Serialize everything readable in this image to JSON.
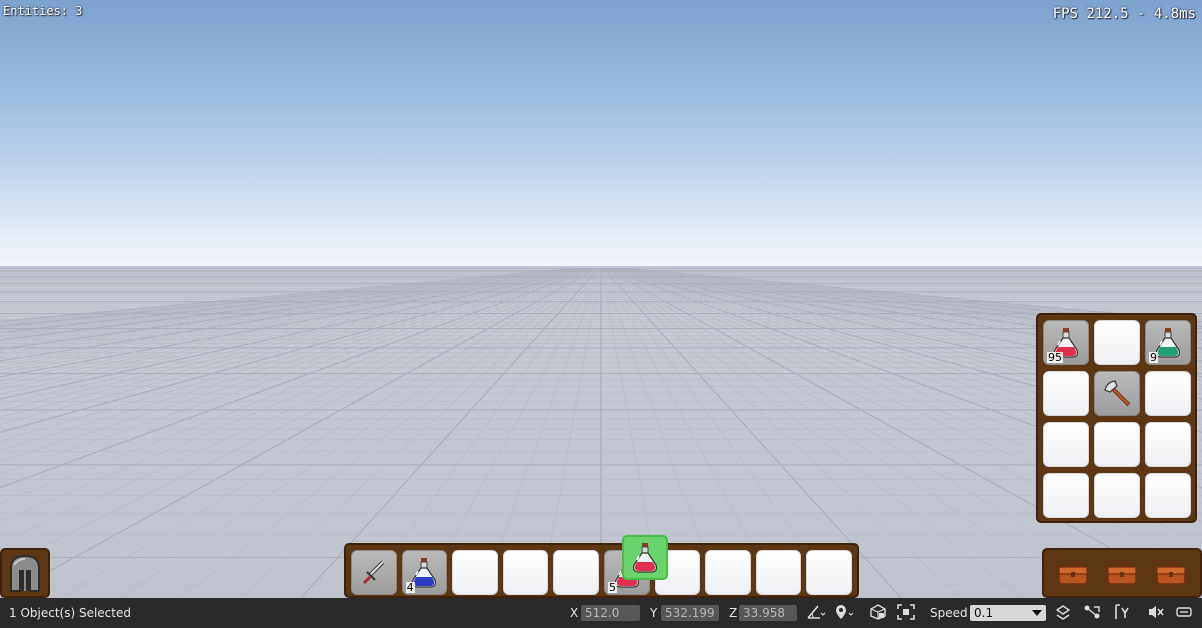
{
  "overlay": {
    "entities": "Entities: 3",
    "fps": "FPS 212.5 - 4.8ms"
  },
  "hotbar": {
    "slots": [
      {
        "item": "sword-icon",
        "count": ""
      },
      {
        "item": "blue-potion-icon",
        "count": "4"
      },
      {
        "item": "",
        "count": ""
      },
      {
        "item": "",
        "count": ""
      },
      {
        "item": "",
        "count": ""
      },
      {
        "item": "red-potion-icon",
        "count": "5"
      },
      {
        "item": "",
        "count": ""
      },
      {
        "item": "",
        "count": ""
      },
      {
        "item": "",
        "count": ""
      },
      {
        "item": "",
        "count": ""
      }
    ]
  },
  "inventory": {
    "slots": [
      {
        "item": "red-potion-icon",
        "count": "95"
      },
      {
        "item": "",
        "count": ""
      },
      {
        "item": "green-potion-icon",
        "count": "9"
      },
      {
        "item": "",
        "count": ""
      },
      {
        "item": "axe-icon",
        "count": ""
      },
      {
        "item": "",
        "count": ""
      },
      {
        "item": "",
        "count": ""
      },
      {
        "item": "",
        "count": ""
      },
      {
        "item": "",
        "count": ""
      },
      {
        "item": "",
        "count": ""
      },
      {
        "item": "",
        "count": ""
      },
      {
        "item": "",
        "count": ""
      }
    ]
  },
  "drag_item": {
    "item": "red-potion-icon"
  },
  "bags": [
    "bag-icon",
    "bag-icon",
    "bag-icon"
  ],
  "equipment": {
    "item": "helmet-icon"
  },
  "statusbar": {
    "selection": "1 Object(s) Selected",
    "x_label": "X",
    "x_value": "512.0",
    "y_label": "Y",
    "y_value": "532.199",
    "z_label": "Z",
    "z_value": "33.958",
    "speed_label": "Speed",
    "speed_value": "0.1"
  },
  "colors": {
    "panel": "#5d3613",
    "statusbar": "#2a2a2a",
    "drag_highlight": "#6bd36b"
  }
}
